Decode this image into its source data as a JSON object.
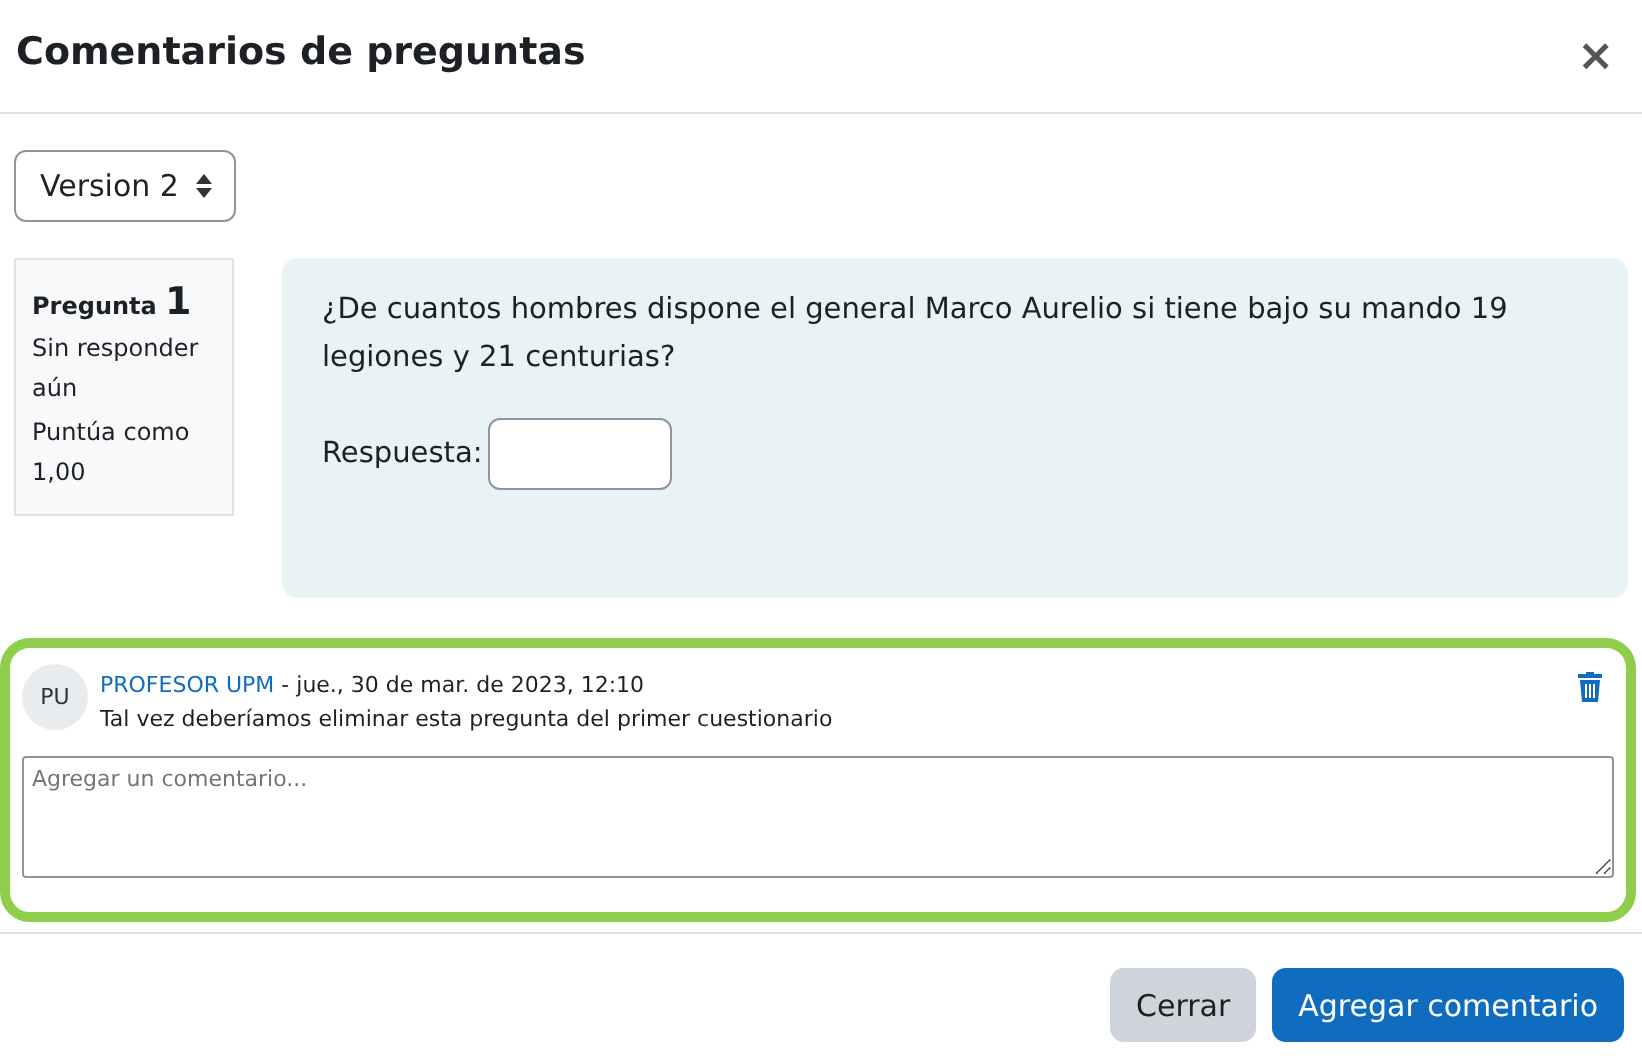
{
  "dialog": {
    "title": "Comentarios de preguntas",
    "close": "×"
  },
  "version_select": {
    "value": "Version 2"
  },
  "question_info": {
    "label": "Pregunta",
    "number": "1",
    "status": "Sin responder aún",
    "grade": "Puntúa como 1,00"
  },
  "question": {
    "text": "¿De cuantos hombres dispone el general Marco Aurelio si tiene bajo su mando 19 legiones y 21 centurias?",
    "answer_label": "Respuesta:"
  },
  "comments": [
    {
      "avatar": "PU",
      "author": "PROFESOR UPM",
      "date": " - jue., 30 de mar. de 2023, 12:10",
      "text": "Tal vez deberíamos eliminar esta pregunta del primer cuestionario"
    }
  ],
  "comment_field": {
    "placeholder": "Agregar un comentario..."
  },
  "buttons": [
    {
      "label": "Cerrar",
      "kind": "secondary"
    },
    {
      "label": "Agregar comentario",
      "kind": "primary"
    }
  ]
}
